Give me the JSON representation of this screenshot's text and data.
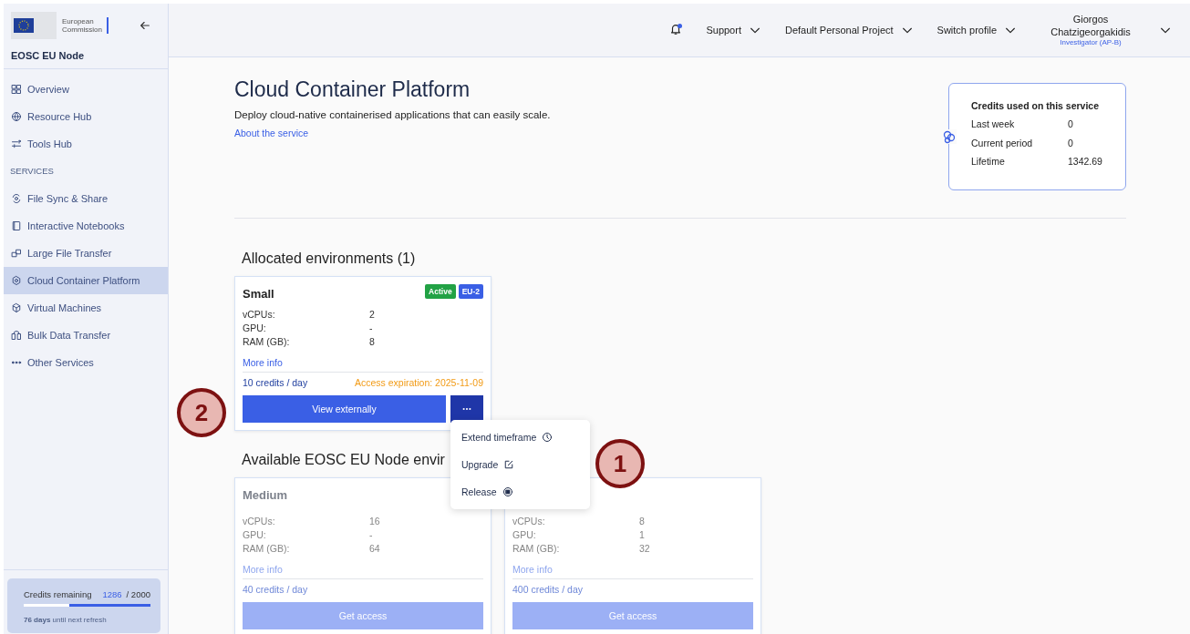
{
  "sidebar": {
    "logo_text": "European Commission",
    "title": "EOSC EU Node",
    "items": [
      {
        "label": "Overview",
        "selected": false
      },
      {
        "label": "Resource Hub",
        "selected": false
      },
      {
        "label": "Tools Hub",
        "selected": false
      },
      {
        "kind": "section",
        "label": "SERVICES"
      },
      {
        "label": "File Sync & Share",
        "selected": false
      },
      {
        "label": "Interactive Notebooks",
        "selected": false
      },
      {
        "label": "Large File Transfer",
        "selected": false
      },
      {
        "label": "Cloud Container Platform",
        "selected": true
      },
      {
        "label": "Virtual Machines",
        "selected": false
      },
      {
        "label": "Bulk Data Transfer",
        "selected": false
      },
      {
        "label": "Other Services",
        "selected": false
      }
    ],
    "credits": {
      "label": "Credits remaining",
      "remaining": "1286",
      "total": "/ 2000",
      "level": 0.643,
      "note": "**76 days** until next refresh"
    }
  },
  "topbar": {
    "menus": [
      "Support",
      "Default Personal Project",
      "Switch profile"
    ],
    "user": {
      "name": "Giorgos Chatzigeorgakidis",
      "role": "Investigator (AP-B)"
    }
  },
  "page": {
    "title": "Cloud Container Platform",
    "description": "Deploy cloud-native containerised applications that can easily scale.",
    "link": "About the service",
    "credits_card": {
      "title": "Credits used on this service",
      "rows": [
        {
          "label": "Last week",
          "value": "0"
        },
        {
          "label": "Current period",
          "value": "0"
        },
        {
          "label": "Lifetime",
          "value": "1342.69"
        }
      ]
    },
    "allocated": {
      "heading": "Allocated environments (1)",
      "environments": [
        {
          "title": "Small",
          "badges": [
            {
              "label": "Active",
              "color": "#22a245"
            },
            {
              "label": "EU-2",
              "color": "#3a5fe5"
            }
          ],
          "specs": [
            {
              "label": "vCPUs:",
              "value": "2"
            },
            {
              "label": "GPU:",
              "value": "-"
            },
            {
              "label": "RAM (GB):",
              "value": "8"
            }
          ],
          "more_info": "More info",
          "credits": "10 credits / day",
          "expiration": "Access expiration: 2025-11-09",
          "button": "View externally",
          "menu": [
            {
              "label": "Extend timeframe"
            },
            {
              "label": "Upgrade"
            },
            {
              "label": "Release"
            }
          ]
        }
      ]
    },
    "available": {
      "heading": "Available EOSC EU Node envir",
      "environments": [
        {
          "title": "Medium",
          "disabled": true,
          "specs": [
            {
              "label": "vCPUs:",
              "value": "16"
            },
            {
              "label": "GPU:",
              "value": "-"
            },
            {
              "label": "RAM (GB):",
              "value": "64"
            }
          ],
          "more_info": "More info",
          "credits": "40 credits / day",
          "button": "Get access"
        },
        {
          "disabled": true,
          "specs": [
            {
              "label": "vCPUs:",
              "value": "8"
            },
            {
              "label": "GPU:",
              "value": "1"
            },
            {
              "label": "RAM (GB):",
              "value": "32"
            }
          ],
          "more_info": "More info",
          "credits": "400 credits / day",
          "button": "Get access"
        }
      ]
    }
  },
  "annotations": [
    {
      "label": "2"
    },
    {
      "label": "1"
    }
  ]
}
